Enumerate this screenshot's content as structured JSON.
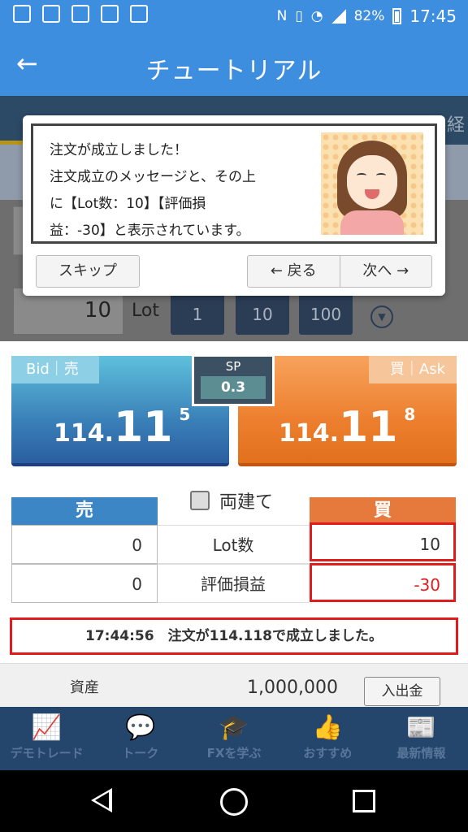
{
  "status_bar": {
    "battery": "82%",
    "time": "17:45"
  },
  "appbar": {
    "back_icon": "←",
    "title": "チュートリアル"
  },
  "background": {
    "tab_partial": "経",
    "lot_value": "10",
    "lot_label": "Lot",
    "lot_buttons": [
      "1",
      "10",
      "100"
    ]
  },
  "tutorial": {
    "lines": [
      "注文が成立しました！",
      "注文成立のメッセージと、その上",
      "に【Lot数：10】【評価損",
      "益：-30】と表示されています。"
    ],
    "skip": "スキップ",
    "prev": "← 戻る",
    "next": "次へ →"
  },
  "bid": {
    "label": "Bid｜売",
    "price_small": "114.",
    "price_big": "11",
    "price_sup": "5"
  },
  "ask": {
    "label": "買｜Ask",
    "price_small": "114.",
    "price_big": "11",
    "price_sup": "8"
  },
  "spread": {
    "label": "SP",
    "value": "0.3"
  },
  "positions": {
    "sell_header": "売",
    "buy_header": "買",
    "hedge_label": "両建て",
    "rows": [
      {
        "label": "Lot数",
        "sell": "0",
        "buy": "10"
      },
      {
        "label": "評価損益",
        "sell": "0",
        "buy": "-30"
      }
    ]
  },
  "notice": "17:44:56　注文が114.118で成立しました。",
  "assets": {
    "label": "資産",
    "value": "1,000,000",
    "button": "入出金"
  },
  "bottom_nav": [
    {
      "label": "デモトレード",
      "icon": "chart-icon"
    },
    {
      "label": "トーク",
      "icon": "chat-icon"
    },
    {
      "label": "FXを学ぶ",
      "icon": "graduation-cap-icon"
    },
    {
      "label": "おすすめ",
      "icon": "thumbs-up-icon"
    },
    {
      "label": "最新情報",
      "icon": "newspaper-icon"
    }
  ],
  "colors": {
    "primary": "#3e8ee0",
    "nav": "#25466c",
    "sell": "#3d86c6",
    "buy": "#e57a3c",
    "alert": "#e01c1c"
  }
}
